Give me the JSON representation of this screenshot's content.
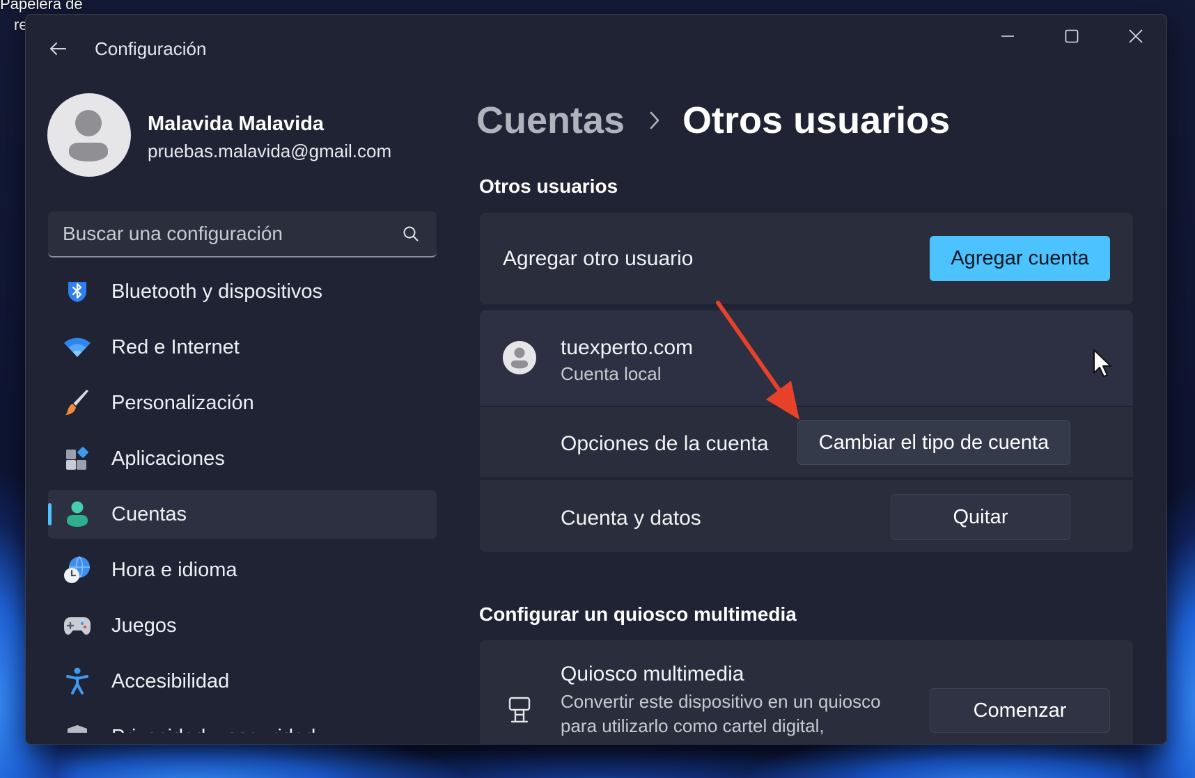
{
  "desktop": {
    "recycle_bin_label_line1": "Papelera de",
    "recycle_bin_label_line2": "re"
  },
  "window": {
    "title": "Configuración",
    "back_icon": "back-arrow-icon",
    "controls": {
      "minimize_icon": "minimize-icon",
      "maximize_icon": "maximize-icon",
      "close_icon": "close-icon"
    }
  },
  "profile": {
    "name": "Malavida Malavida",
    "email": "pruebas.malavida@gmail.com",
    "avatar_icon": "user-avatar-icon"
  },
  "search": {
    "placeholder": "Buscar una configuración",
    "value": "",
    "icon": "search-icon"
  },
  "sidebar": {
    "selected_index": 4,
    "items": [
      {
        "label": "Bluetooth y dispositivos",
        "icon": "bluetooth-icon"
      },
      {
        "label": "Red e Internet",
        "icon": "wifi-icon"
      },
      {
        "label": "Personalización",
        "icon": "paintbrush-icon"
      },
      {
        "label": "Aplicaciones",
        "icon": "apps-icon"
      },
      {
        "label": "Cuentas",
        "icon": "person-icon"
      },
      {
        "label": "Hora e idioma",
        "icon": "globe-clock-icon"
      },
      {
        "label": "Juegos",
        "icon": "gamepad-icon"
      },
      {
        "label": "Accesibilidad",
        "icon": "accessibility-icon"
      },
      {
        "label": "Privacidad y seguridad",
        "icon": "shield-icon"
      }
    ]
  },
  "breadcrumb": {
    "parent": "Cuentas",
    "current": "Otros usuarios",
    "separator_icon": "chevron-right-icon"
  },
  "other_users": {
    "heading": "Otros usuarios",
    "add_user": {
      "label": "Agregar otro usuario",
      "button": "Agregar cuenta"
    },
    "users": [
      {
        "name": "tuexperto.com",
        "type": "Cuenta local",
        "icon": "user-avatar-icon",
        "expanded": true,
        "options": [
          {
            "label": "Opciones de la cuenta",
            "button": "Cambiar el tipo de cuenta"
          },
          {
            "label": "Cuenta y datos",
            "button": "Quitar"
          }
        ]
      }
    ]
  },
  "kiosk": {
    "heading": "Configurar un quiosco multimedia",
    "title": "Quiosco multimedia",
    "description_lines": [
      "Convertir este dispositivo en un quiosco",
      "para utilizarlo como cartel digital,"
    ],
    "button": "Comenzar",
    "icon": "kiosk-icon"
  },
  "overlay": {
    "annotation_icon": "red-arrow-icon",
    "cursor_icon": "mouse-cursor-icon"
  },
  "theme": {
    "accent": "#4cc2ff",
    "annotation": "#e8412a",
    "window_bg": "#1f2334",
    "card_bg": "#292d3c"
  }
}
